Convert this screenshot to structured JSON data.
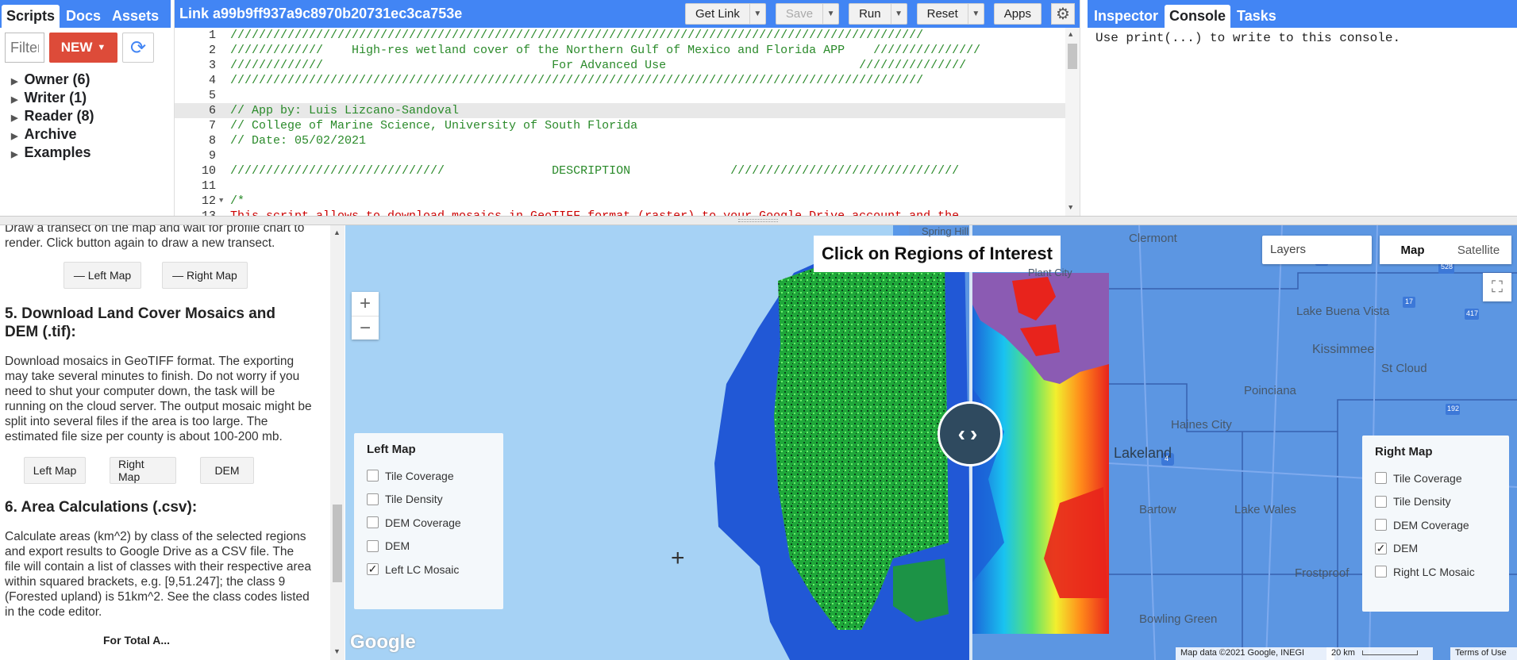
{
  "left_panel_tabs": [
    "Scripts",
    "Docs",
    "Assets"
  ],
  "script_controls": {
    "filter_placeholder": "Filter",
    "new_label": "NEW"
  },
  "script_tree": [
    "Owner (6)",
    "Writer (1)",
    "Reader (8)",
    "Archive",
    "Examples"
  ],
  "editor": {
    "title": "Link a99b9ff937a9c8970b20731ec3ca753e",
    "buttons": {
      "get_link": "Get Link",
      "save": "Save",
      "run": "Run",
      "reset": "Reset",
      "apps": "Apps"
    },
    "lines": [
      {
        "n": "1",
        "t": "/////////////////////////////////////////////////////////////////////////////////////////////////"
      },
      {
        "n": "2",
        "t": "/////////////    High-res wetland cover of the Northern Gulf of Mexico and Florida APP    ///////////////"
      },
      {
        "n": "3",
        "t": "/////////////                                For Advanced Use                           ///////////////"
      },
      {
        "n": "4",
        "t": "/////////////////////////////////////////////////////////////////////////////////////////////////"
      },
      {
        "n": "5",
        "t": ""
      },
      {
        "n": "6",
        "t": "// App by: Luis Lizcano-Sandoval"
      },
      {
        "n": "7",
        "t": "// College of Marine Science, University of South Florida"
      },
      {
        "n": "8",
        "t": "// Date: 05/02/2021"
      },
      {
        "n": "9",
        "t": ""
      },
      {
        "n": "10",
        "t": "//////////////////////////////               DESCRIPTION              ////////////////////////////////"
      },
      {
        "n": "11",
        "t": ""
      },
      {
        "n": "12",
        "t": "/*"
      },
      {
        "n": "13",
        "t": "This script allows to download mosaics in GeoTIFF format (raster) to your Google Drive account and the"
      }
    ]
  },
  "right_panel_tabs": [
    "Inspector",
    "Console",
    "Tasks"
  ],
  "console_text": "Use print(...) to write to this console.",
  "panel": {
    "top_text": "Draw a transect on the map and wait for profile chart to render. Click button again to draw a new transect.",
    "transect_buttons": [
      "— Left Map",
      "— Right Map"
    ],
    "section5_title": "5. Download Land Cover Mosaics and DEM (.tif):",
    "section5_text": "Download mosaics in GeoTIFF format. The exporting may take several minutes to finish. Do not worry if you need to shut your computer down, the task will be running on the cloud server. The output mosaic might be split into several files if the area is too large. The estimated file size per county is about 100-200 mb.",
    "download_buttons": [
      "Left Map",
      "Right Map",
      "DEM"
    ],
    "section6_title": "6. Area Calculations (.csv):",
    "section6_text": "Calculate areas (km^2) by class of the selected regions and export results to Google Drive as a CSV file. The file will contain a list of classes with their respective area within squared brackets, e.g. [9,51.247]; the class 9 (Forested upland) is 51km^2. See the class codes listed in the code editor.",
    "cut_off_text": "For Total A..."
  },
  "map": {
    "title": "Click on Regions of Interest",
    "layers_label": "Layers",
    "map_type": [
      "Map",
      "Satellite"
    ],
    "left_legend": {
      "title": "Left Map",
      "items": [
        {
          "label": "Tile Coverage",
          "checked": false
        },
        {
          "label": "Tile Density",
          "checked": false
        },
        {
          "label": "DEM Coverage",
          "checked": false
        },
        {
          "label": "DEM",
          "checked": false
        },
        {
          "label": "Left LC Mosaic",
          "checked": true
        }
      ]
    },
    "right_legend": {
      "title": "Right Map",
      "items": [
        {
          "label": "Tile Coverage",
          "checked": false
        },
        {
          "label": "Tile Density",
          "checked": false
        },
        {
          "label": "DEM Coverage",
          "checked": false
        },
        {
          "label": "DEM",
          "checked": true
        },
        {
          "label": "Right LC Mosaic",
          "checked": false
        }
      ]
    },
    "places": [
      "Clermont",
      "Lake Buena Vista",
      "Kissimmee",
      "St Cloud",
      "Poinciana",
      "Haines City",
      "Lakeland",
      "Bartow",
      "Lake Wales",
      "Frostproof",
      "Bowling Green",
      "Spring Hill",
      "Plant City"
    ],
    "road_shields": [
      "50",
      "528",
      "417",
      "192",
      "4",
      "17"
    ],
    "google_logo": "Google",
    "attribution": "Map data ©2021 Google, INEGI",
    "scale": "20 km",
    "terms": "Terms of Use"
  }
}
